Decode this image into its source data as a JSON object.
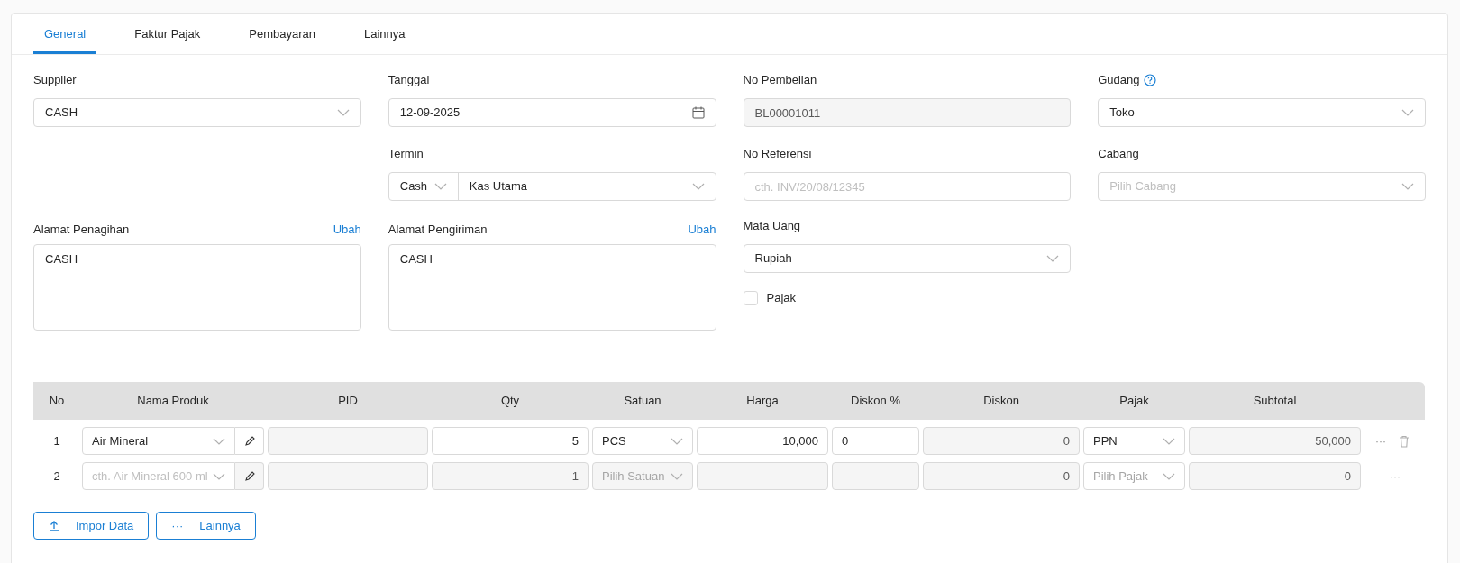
{
  "tabs": [
    {
      "label": "General",
      "selected": true
    },
    {
      "label": "Faktur Pajak",
      "selected": false
    },
    {
      "label": "Pembayaran",
      "selected": false
    },
    {
      "label": "Lainnya",
      "selected": false
    }
  ],
  "fields": {
    "supplier": {
      "label": "Supplier",
      "value": "CASH"
    },
    "tanggal": {
      "label": "Tanggal",
      "value": "12-09-2025"
    },
    "no_pembelian": {
      "label": "No Pembelian",
      "value": "BL00001011",
      "disabled": true
    },
    "gudang": {
      "label": "Gudang",
      "value": "Toko"
    },
    "termin": {
      "label": "Termin",
      "value": "Cash",
      "account": "Kas Utama"
    },
    "no_referensi": {
      "label": "No Referensi",
      "placeholder": "cth. INV/20/08/12345"
    },
    "cabang": {
      "label": "Cabang",
      "placeholder": "Pilih Cabang"
    },
    "alamat_penagihan": {
      "label": "Alamat Penagihan",
      "link": "Ubah",
      "value": "CASH"
    },
    "alamat_pengiriman": {
      "label": "Alamat Pengiriman",
      "link": "Ubah",
      "value": "CASH"
    },
    "mata_uang": {
      "label": "Mata Uang",
      "value": "Rupiah"
    },
    "pajak": {
      "label": "Pajak",
      "checked": false
    }
  },
  "table": {
    "columns": [
      "No",
      "Nama Produk",
      "PID",
      "Qty",
      "Satuan",
      "Harga",
      "Diskon %",
      "Diskon",
      "Pajak",
      "Subtotal"
    ],
    "rows": [
      {
        "no": "1",
        "disabled": false,
        "deletable": true,
        "product": {
          "value": "Air Mineral"
        },
        "pid": "",
        "qty": "5",
        "satuan": {
          "value": "PCS"
        },
        "harga": "10,000",
        "diskon_pct": "0",
        "diskon": "0",
        "pajak": {
          "value": "PPN"
        },
        "subtotal": "50,000",
        "more": "···"
      },
      {
        "no": "2",
        "disabled": true,
        "deletable": false,
        "product": {
          "placeholder": "cth. Air Mineral 600 ml"
        },
        "pid": "",
        "qty": "1",
        "satuan": {
          "placeholder": "Pilih Satuan"
        },
        "harga": "",
        "diskon_pct": "",
        "diskon": "0",
        "pajak": {
          "placeholder": "Pilih Pajak"
        },
        "subtotal": "0",
        "more": "···"
      }
    ]
  },
  "buttons": [
    {
      "kind": "upload",
      "label": "Impor Data"
    },
    {
      "kind": "more",
      "label": "Lainnya",
      "icon": "···"
    }
  ]
}
